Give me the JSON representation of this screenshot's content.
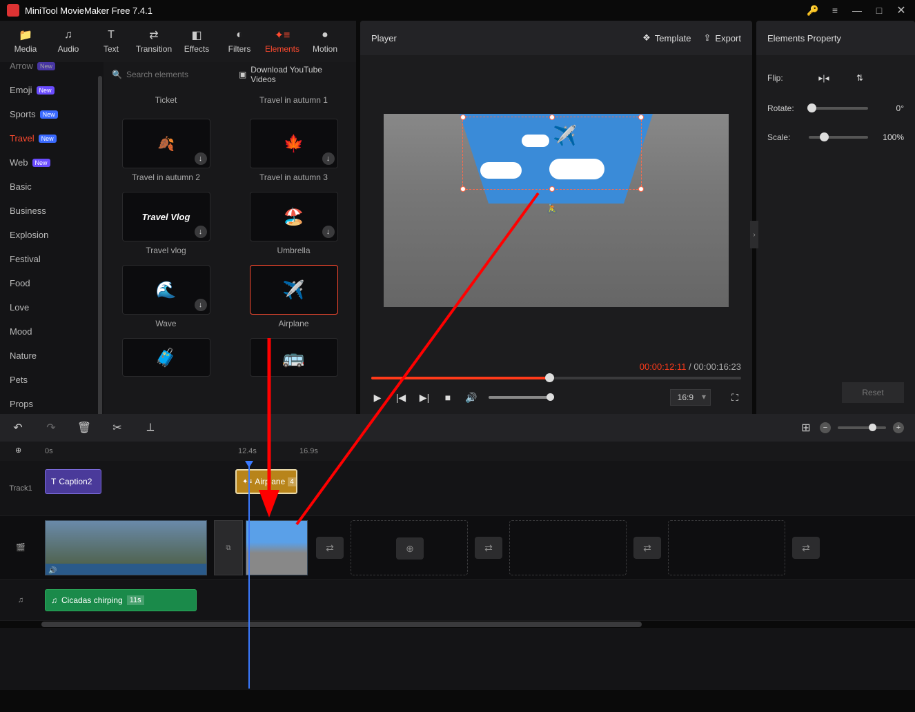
{
  "app": {
    "title": "MiniTool MovieMaker Free 7.4.1"
  },
  "tabs": {
    "media": "Media",
    "audio": "Audio",
    "text": "Text",
    "transition": "Transition",
    "effects": "Effects",
    "filters": "Filters",
    "elements": "Elements",
    "motion": "Motion",
    "active": "elements"
  },
  "search": {
    "placeholder": "Search elements",
    "download_yt": "Download YouTube Videos"
  },
  "categories": [
    {
      "label": "Arrow",
      "badge": "New",
      "badge_cls": "badge-new",
      "cut": true
    },
    {
      "label": "Emoji",
      "badge": "New",
      "badge_cls": "badge-new"
    },
    {
      "label": "Sports",
      "badge": "New",
      "badge_cls": "badge-new2"
    },
    {
      "label": "Travel",
      "badge": "New",
      "badge_cls": "badge-new2",
      "active": true
    },
    {
      "label": "Web",
      "badge": "New",
      "badge_cls": "badge-new"
    },
    {
      "label": "Basic"
    },
    {
      "label": "Business"
    },
    {
      "label": "Explosion"
    },
    {
      "label": "Festival"
    },
    {
      "label": "Food"
    },
    {
      "label": "Love"
    },
    {
      "label": "Mood"
    },
    {
      "label": "Nature"
    },
    {
      "label": "Pets"
    },
    {
      "label": "Props"
    }
  ],
  "thumbs": {
    "row1": {
      "a": "Ticket",
      "b": "Travel in autumn 1"
    },
    "row2": {
      "a": "Travel in autumn 2",
      "b": "Travel in autumn 3"
    },
    "row3": {
      "a": "Travel vlog",
      "b": "Umbrella"
    },
    "row4": {
      "a": "Wave",
      "b": "Airplane"
    },
    "row5": {
      "a": "",
      "b": ""
    }
  },
  "player": {
    "title": "Player",
    "template": "Template",
    "export": "Export",
    "time_current": "00:00:12:11",
    "time_total": "00:00:16:23",
    "aspect": "16:9"
  },
  "props": {
    "title": "Elements Property",
    "flip": "Flip:",
    "rotate": "Rotate:",
    "scale": "Scale:",
    "rotate_val": "0°",
    "scale_val": "100%",
    "reset": "Reset"
  },
  "timeline": {
    "zero": "0s",
    "mark1": "12.4s",
    "mark2": "16.9s",
    "track1": "Track1",
    "caption_clip": "Caption2",
    "element_clip": "Airplane",
    "element_dur": "4",
    "audio_clip": "Cicadas chirping",
    "audio_dur": "11s"
  }
}
